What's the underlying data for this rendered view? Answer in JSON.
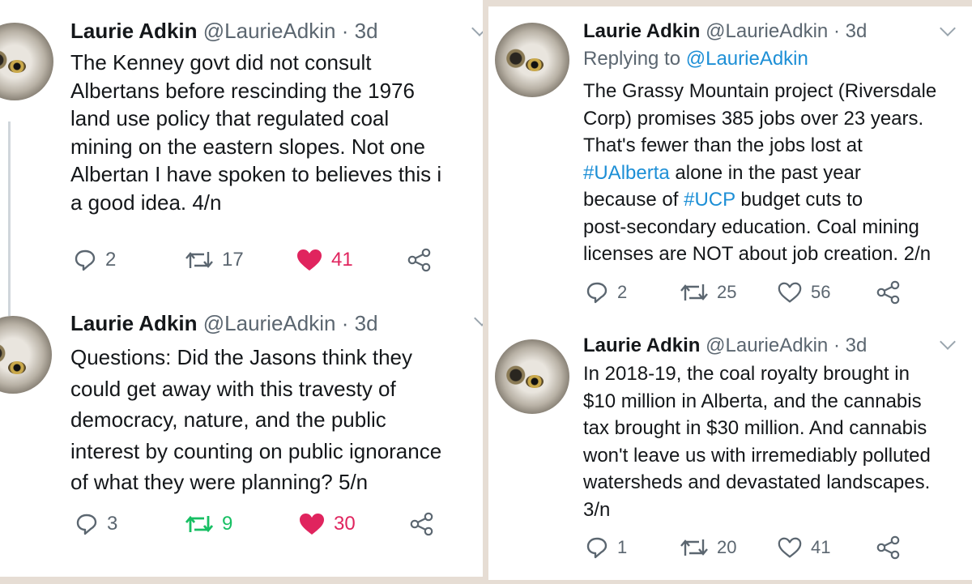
{
  "left": {
    "tweets": [
      {
        "name": "Laurie Adkin",
        "handle": "@LaurieAdkin",
        "dot": "·",
        "time": "3d",
        "text": "The Kenney govt did not consult\nAlbertans before rescinding the 1976\nland use policy that regulated coal\nmining on the eastern slopes. Not one\nAlbertan I have spoken to believes this i\na good idea. 4/n",
        "replies": "2",
        "retweets": "17",
        "likes": "41",
        "liked": true,
        "retweeted": false
      },
      {
        "name": "Laurie Adkin",
        "handle": "@LaurieAdkin",
        "dot": "·",
        "time": "3d",
        "text": "Questions: Did the Jasons think they\ncould get away with this travesty of\ndemocracy, nature, and the public\ninterest by counting on public ignorance\nof what they were planning? 5/n",
        "replies": "3",
        "retweets": "9",
        "likes": "30",
        "liked": true,
        "retweeted": true
      }
    ]
  },
  "right": {
    "tweets": [
      {
        "name": "Laurie Adkin",
        "handle": "@LaurieAdkin",
        "dot": "·",
        "time": "3d",
        "replying_label": "Replying to",
        "replying_handle": "@LaurieAdkin",
        "text_1": "The Grassy Mountain project (Riversdale\nCorp) promises 385 jobs over 23 years.\nThat's fewer than the jobs lost at\n",
        "hashtag_1": "#UAlberta",
        "text_2": " alone in the past year\nbecause of ",
        "hashtag_2": "#UCP",
        "text_3": " budget cuts to\npost-secondary education.  Coal mining\nlicenses are NOT about job creation. 2/n",
        "replies": "2",
        "retweets": "25",
        "likes": "56",
        "liked": false,
        "retweeted": false
      },
      {
        "name": "Laurie Adkin",
        "handle": "@LaurieAdkin",
        "dot": "·",
        "time": "3d",
        "text": "In 2018-19, the coal royalty brought in\n$10 million in Alberta, and the cannabis\ntax brought in $30 million. And cannabis\nwon't leave us with irremediably polluted\nwatersheds and devastated landscapes.\n3/n",
        "replies": "1",
        "retweets": "20",
        "likes": "41",
        "liked": false,
        "retweeted": false
      }
    ]
  },
  "colors": {
    "like_red": "#e0245e",
    "retweet_green": "#17bf63",
    "link_blue": "#1d8fd6",
    "muted": "#5b6670"
  },
  "icons": [
    "reply-icon",
    "retweet-icon",
    "like-icon",
    "share-icon",
    "chevron-down-icon",
    "avatar"
  ]
}
